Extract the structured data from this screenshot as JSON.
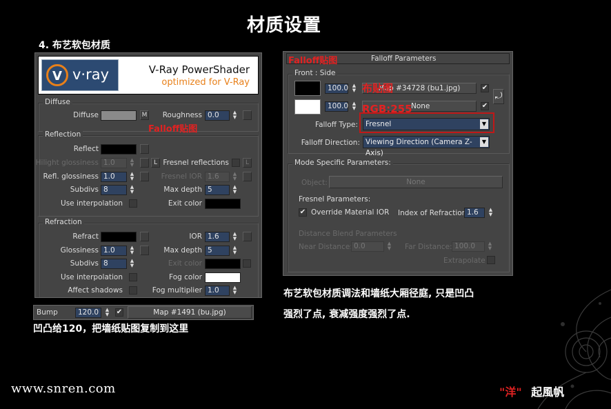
{
  "page_title": "材质设置",
  "section_title": "4. 布艺软包材质",
  "vray_header": {
    "brand": "v·ray",
    "heading": "V-Ray PowerShader",
    "subheading": "optimized for V-Ray"
  },
  "diffuse": {
    "group": "Diffuse",
    "label": "Diffuse",
    "map_btn": "M",
    "roughness_label": "Roughness",
    "roughness_value": "0.0",
    "annotation": "Falloff贴图"
  },
  "reflection": {
    "group": "Reflection",
    "reflect_label": "Reflect",
    "hilight_label": "Hilight glossiness",
    "hilight_value": "1.0",
    "lock_btn": "L",
    "fresnel_label": "Fresnel reflections",
    "fresnel_lock": "L",
    "refl_gloss_label": "Refl. glossiness",
    "refl_gloss_value": "1.0",
    "fresnel_ior_label": "Fresnel IOR",
    "fresnel_ior_value": "1.6",
    "subdivs_label": "Subdivs",
    "subdivs_value": "8",
    "max_depth_label": "Max depth",
    "max_depth_value": "5",
    "interp_label": "Use interpolation",
    "exit_color_label": "Exit color"
  },
  "refraction": {
    "group": "Refraction",
    "refract_label": "Refract",
    "ior_label": "IOR",
    "ior_value": "1.6",
    "gloss_label": "Glossiness",
    "gloss_value": "1.0",
    "max_depth_label": "Max depth",
    "max_depth_value": "5",
    "subdivs_label": "Subdivs",
    "subdivs_value": "8",
    "exit_color_label": "Exit color",
    "interp_label": "Use interpolation",
    "fog_color_label": "Fog color",
    "affect_shadows_label": "Affect shadows",
    "fog_mult_label": "Fog multiplier",
    "fog_mult_value": "1.0"
  },
  "bump": {
    "label": "Bump",
    "value": "120.0",
    "map": "Map #1491 (bu.jpg)",
    "caption": "凹凸给120，把墙纸贴图复制到这里"
  },
  "falloff": {
    "annotation_title": "Falloff贴图",
    "rollout_title": "Falloff Parameters",
    "front_side": "Front : Side",
    "value1": "100.0",
    "map1": "Map #34728 (bu1.jpg)",
    "map1_annotation": "布贴图",
    "value2": "100.0",
    "map2": "None",
    "map2_annotation": "RGB:255",
    "falloff_type_label": "Falloff Type:",
    "falloff_type_value": "Fresnel",
    "falloff_dir_label": "Falloff Direction:",
    "falloff_dir_value": "Viewing Direction (Camera Z-Axis)",
    "mode_group": "Mode Specific Parameters:",
    "object_label": "Object:",
    "object_value": "None",
    "fresnel_params": "Fresnel Parameters:",
    "override_ior": "Override Material IOR",
    "ior_label": "Index of Refraction",
    "ior_value": "1.6",
    "dist_blend": "Distance Blend Parameters",
    "near_label": "Near Distance:",
    "near_value": "0.0",
    "far_label": "Far Distance:",
    "far_value": "100.0",
    "extrapolate": "Extrapolate"
  },
  "description": {
    "line1": "布艺软包材质调法和墙纸大厢径庭, 只是凹凸",
    "line2": "强烈了点, 衰减强度强烈了点."
  },
  "footer": {
    "website": "www.snren.com",
    "author_quote": "\"洋\"",
    "author_name": "起風帆"
  },
  "colors": {
    "accent_red": "#e02222",
    "vray_orange": "#e8801a"
  }
}
